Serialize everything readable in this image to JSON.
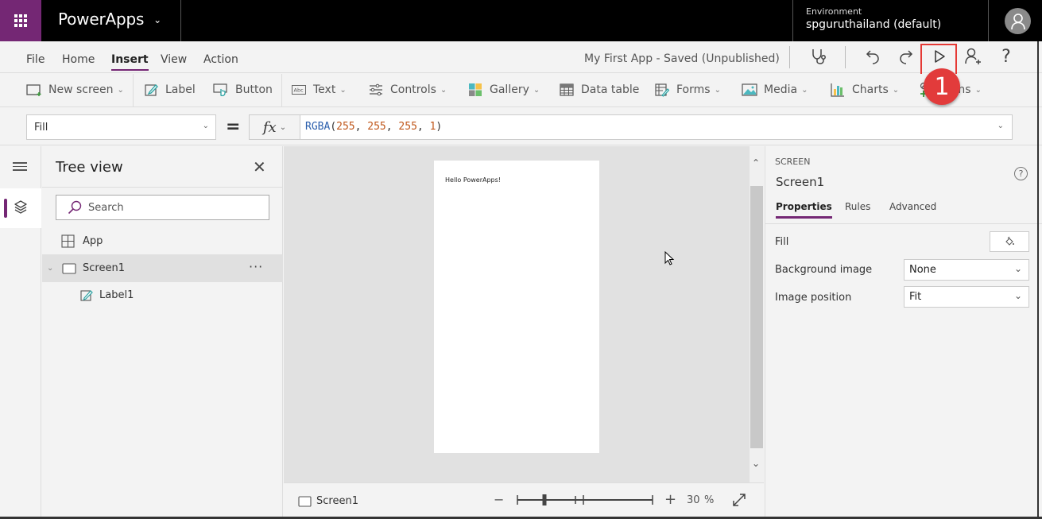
{
  "header": {
    "app_name": "PowerApps",
    "environment_label": "Environment",
    "environment_value": "spguruthailand (default)"
  },
  "menu": {
    "tabs": [
      {
        "label": "File",
        "active": false
      },
      {
        "label": "Home",
        "active": false
      },
      {
        "label": "Insert",
        "active": true
      },
      {
        "label": "View",
        "active": false
      },
      {
        "label": "Action",
        "active": false
      }
    ],
    "app_status": "My First App - Saved (Unpublished)",
    "callout_number": "1"
  },
  "ribbon": {
    "items": [
      {
        "label": "New screen",
        "icon": "new-screen-icon",
        "dropdown": true
      },
      {
        "label": "Label",
        "icon": "label-edit-icon",
        "dropdown": false
      },
      {
        "label": "Button",
        "icon": "button-pointer-icon",
        "dropdown": false
      },
      {
        "label": "Text",
        "icon": "text-abc-icon",
        "dropdown": true
      },
      {
        "label": "Controls",
        "icon": "sliders-icon",
        "dropdown": true
      },
      {
        "label": "Gallery",
        "icon": "gallery-icon",
        "dropdown": true
      },
      {
        "label": "Data table",
        "icon": "table-icon",
        "dropdown": false
      },
      {
        "label": "Forms",
        "icon": "form-icon",
        "dropdown": true
      },
      {
        "label": "Media",
        "icon": "image-icon",
        "dropdown": true
      },
      {
        "label": "Charts",
        "icon": "bar-chart-icon",
        "dropdown": true
      },
      {
        "label": "Icons",
        "icon": "icons-icon",
        "dropdown": true
      }
    ]
  },
  "formula": {
    "property": "Fill",
    "equals": "=",
    "fx": "fx",
    "function_name": "RGBA",
    "args": [
      "255",
      "255",
      "255",
      "1"
    ]
  },
  "tree": {
    "title": "Tree view",
    "search_placeholder": "Search",
    "items": [
      {
        "label": "App",
        "icon": "app-icon",
        "level": 0,
        "selected": false
      },
      {
        "label": "Screen1",
        "icon": "screen-icon",
        "level": 0,
        "selected": true,
        "more": "···"
      },
      {
        "label": "Label1",
        "icon": "label-edit-icon",
        "level": 1,
        "selected": false
      }
    ]
  },
  "canvas": {
    "label_text": "Hello PowerApps!"
  },
  "bottom": {
    "screen_name": "Screen1",
    "zoom_value": "30",
    "zoom_unit": "%",
    "zoom_minus": "−",
    "zoom_plus": "+",
    "zoom_percent": 30
  },
  "properties": {
    "type": "SCREEN",
    "name": "Screen1",
    "help": "?",
    "tabs": [
      {
        "label": "Properties",
        "active": true
      },
      {
        "label": "Rules",
        "active": false
      },
      {
        "label": "Advanced",
        "active": false
      }
    ],
    "fill_label": "Fill",
    "fill_color": "#ffffff",
    "background_image_label": "Background image",
    "background_image_value": "None",
    "image_position_label": "Image position",
    "image_position_value": "Fit"
  },
  "colors": {
    "accent": "#742774",
    "callout": "#e23b3b",
    "formula_function": "#2b5fad",
    "formula_number": "#c0571b"
  }
}
